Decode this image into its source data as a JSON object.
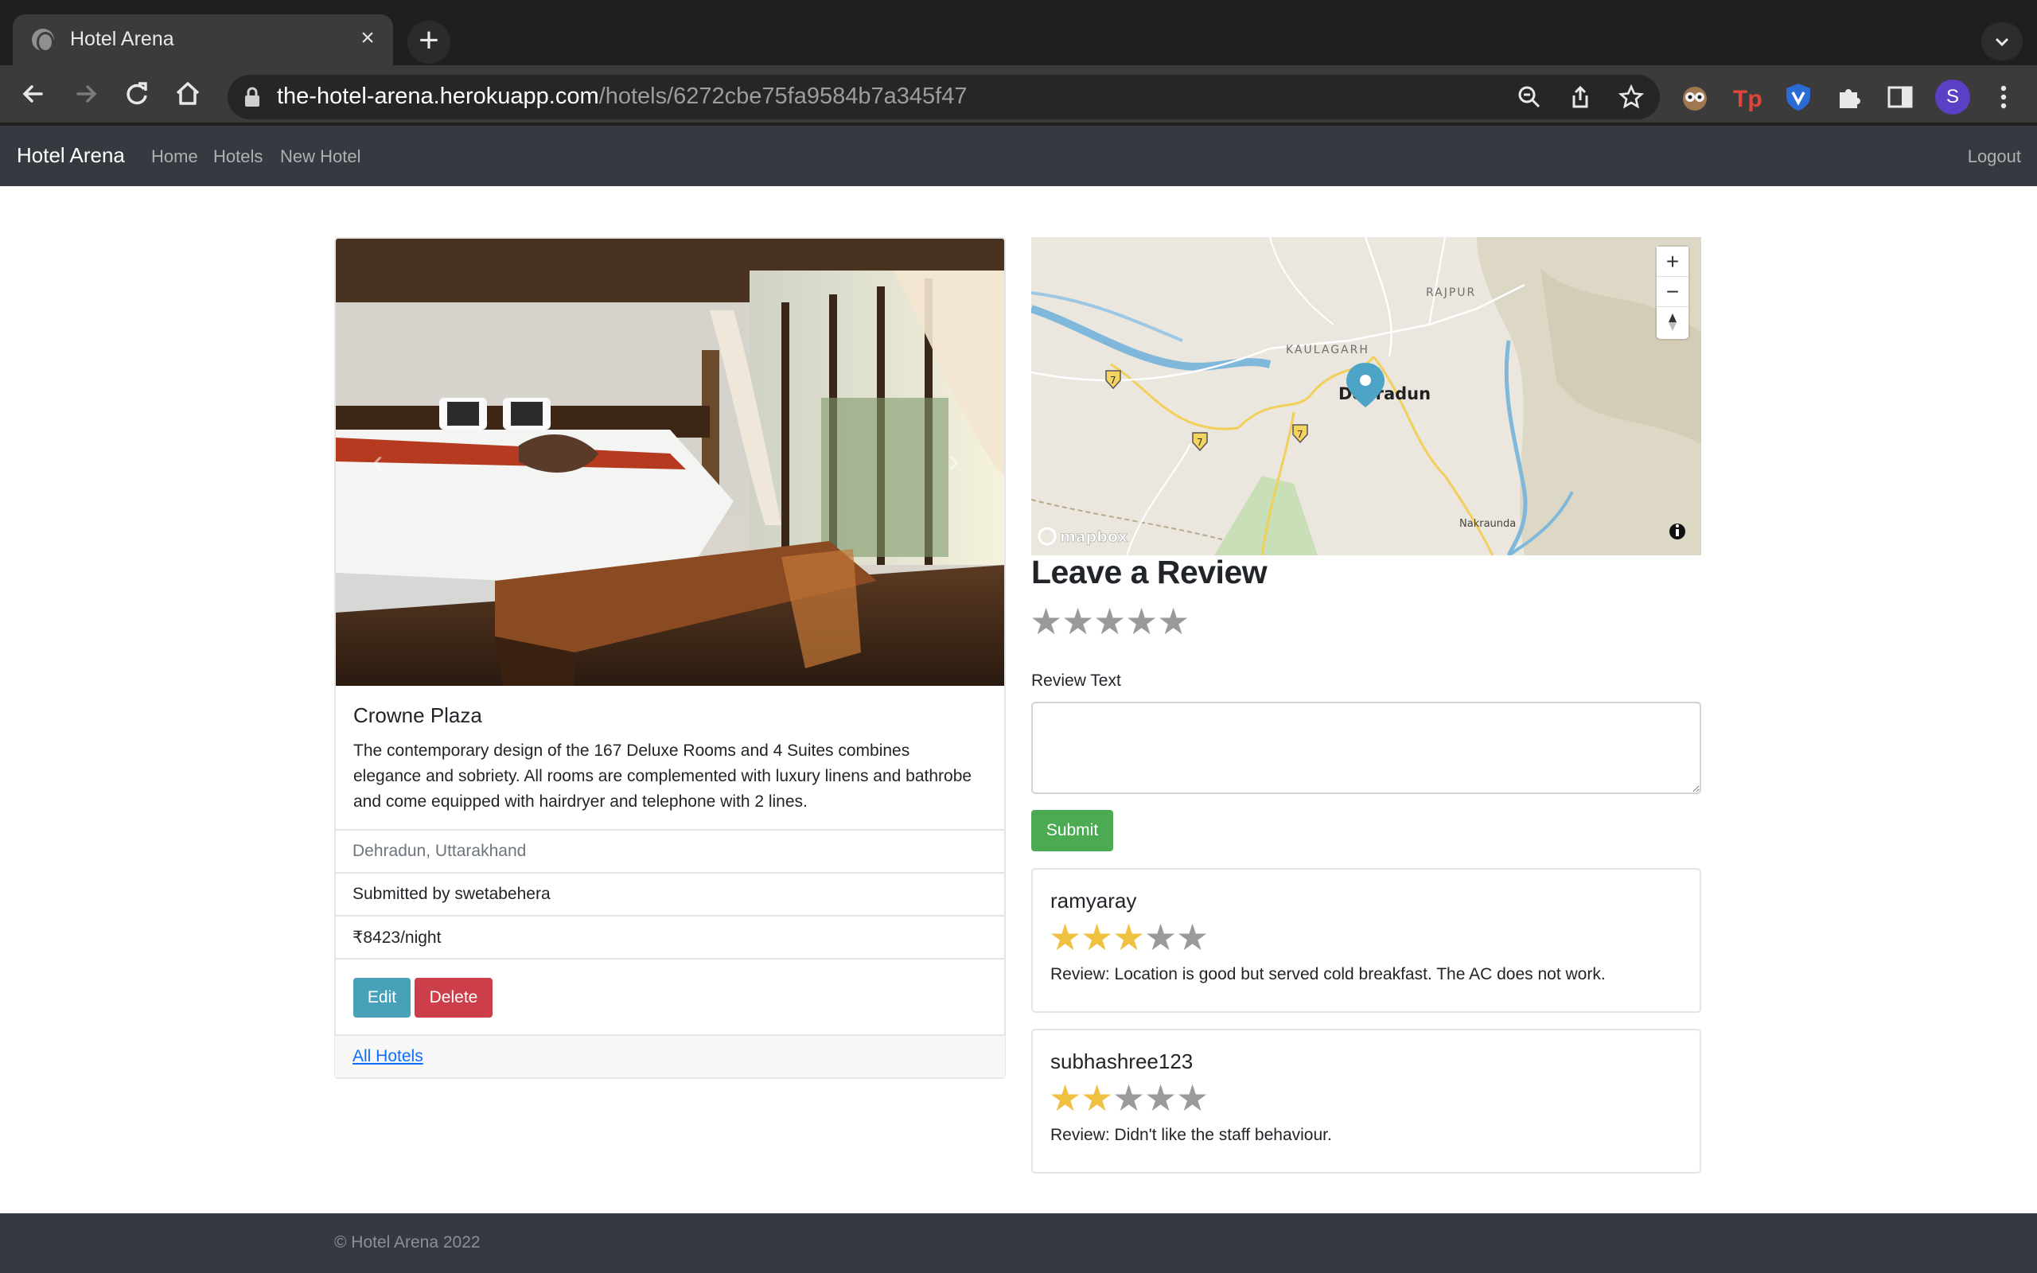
{
  "browser": {
    "tab_title": "Hotel Arena",
    "url_host": "the-hotel-arena.herokuapp.com",
    "url_path": "/hotels/6272cbe75fa9584b7a345f47",
    "profile_initial": "S"
  },
  "navbar": {
    "brand": "Hotel Arena",
    "links": [
      "Home",
      "Hotels",
      "New Hotel"
    ],
    "logout": "Logout"
  },
  "hotel": {
    "name": "Crowne Plaza",
    "description": "The contemporary design of the 167 Deluxe Rooms and 4 Suites combines elegance and sobriety. All rooms are complemented with luxury linens and bathrobe and come equipped with hairdryer and telephone with 2 lines.",
    "location": "Dehradun, Uttarakhand",
    "submitted_by": "Submitted by swetabehera",
    "price": "₹8423/night",
    "edit_label": "Edit",
    "delete_label": "Delete",
    "all_hotels_label": "All Hotels"
  },
  "map": {
    "labels": {
      "city": "Dehradun",
      "rajpur": "RAJPUR",
      "kaulagarh": "KAULAGARH",
      "nakraunda": "Nakraunda"
    },
    "route_badge": "7",
    "attribution": "mapbox",
    "zoom_in": "+",
    "zoom_out": "−"
  },
  "review_form": {
    "heading": "Leave a Review",
    "text_label": "Review Text",
    "text_value": "",
    "submit_label": "Submit",
    "rating": 0
  },
  "reviews": [
    {
      "author": "ramyaray",
      "rating": 3,
      "text": "Review: Location is good but served cold breakfast. The AC does not work."
    },
    {
      "author": "subhashree123",
      "rating": 2,
      "text": "Review: Didn't like the staff behaviour."
    }
  ],
  "footer": {
    "copyright": "© Hotel Arena 2022"
  },
  "colors": {
    "navbar": "#343a40",
    "star_filled": "#f0c040",
    "star_empty": "#9a9a9a",
    "edit": "#47a1b9",
    "delete": "#cc3e4a",
    "submit": "#4caa52"
  }
}
